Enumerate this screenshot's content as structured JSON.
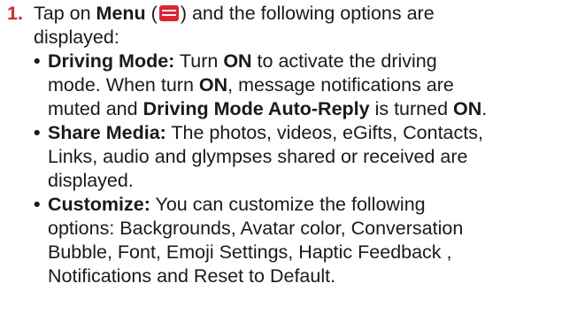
{
  "step": {
    "number": "1.",
    "line1_pre": "Tap on ",
    "line1_menu": "Menu",
    "line1_paren_open": " (",
    "line1_paren_close": ") and the following options are",
    "line2": "displayed:"
  },
  "menu_icon": "hamburger-menu-icon",
  "accent_color": "#e8202a",
  "bullets": [
    {
      "title": "Driving Mode:",
      "lines": [
        [
          " Turn ",
          {
            "b": "ON"
          },
          " to activate the driving"
        ],
        [
          "mode. When turn ",
          {
            "b": "ON"
          },
          ", message notifications are"
        ],
        [
          "muted and ",
          {
            "b": "Driving Mode Auto-Reply"
          },
          " is turned ",
          {
            "b": "ON"
          },
          "."
        ]
      ]
    },
    {
      "title": "Share Media:",
      "lines": [
        [
          " The photos, videos, eGifts, Contacts,"
        ],
        [
          "Links, audio and glympses shared or received are"
        ],
        [
          "displayed."
        ]
      ]
    },
    {
      "title": "Customize:",
      "lines": [
        [
          " You can customize the following"
        ],
        [
          "options: Backgrounds, Avatar color, Conversation"
        ],
        [
          "Bubble, Font, Emoji Settings, Haptic Feedback ,"
        ],
        [
          "Notifications and Reset to Default."
        ]
      ]
    }
  ]
}
